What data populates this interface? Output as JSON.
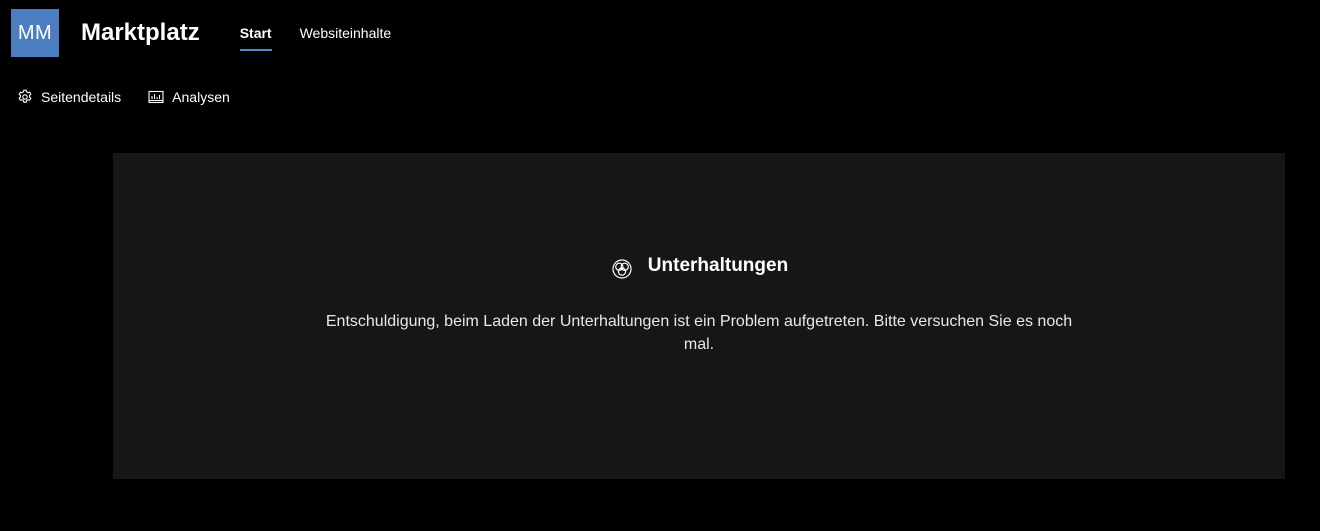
{
  "site": {
    "avatar_initials": "MM",
    "title": "Marktplatz",
    "avatar_color": "#4a7ebf"
  },
  "nav": {
    "items": [
      {
        "label": "Start",
        "active": true
      },
      {
        "label": "Websiteinhalte",
        "active": false
      }
    ],
    "active_indicator_color": "#4f86c6"
  },
  "command_bar": {
    "items": [
      {
        "label": "Seitendetails",
        "icon": "gear-icon"
      },
      {
        "label": "Analysen",
        "icon": "analytics-icon"
      }
    ]
  },
  "conversations": {
    "title": "Unterhaltungen",
    "icon": "conversations-icon",
    "message": "Entschuldigung, beim Laden der Unterhaltungen ist ein Problem aufgetreten. Bitte versuchen Sie es noch mal."
  }
}
